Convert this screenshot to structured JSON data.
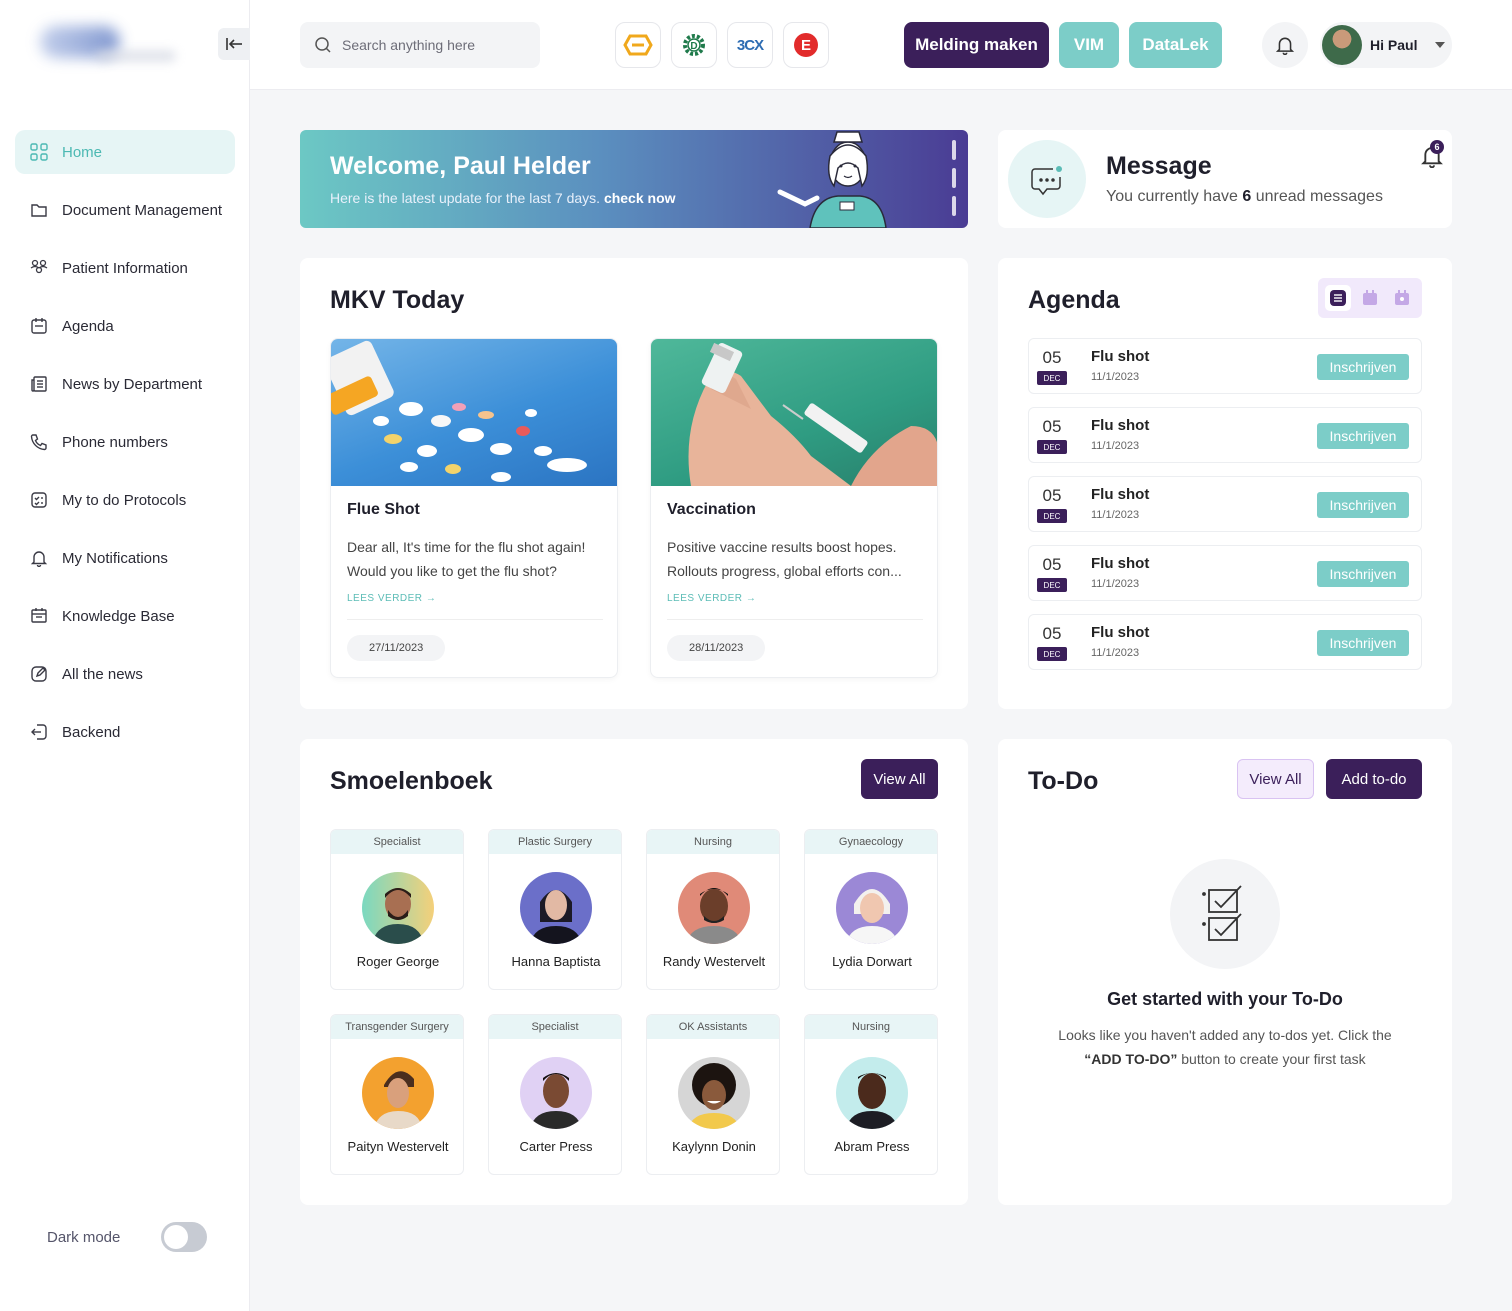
{
  "search": {
    "placeholder": "Search anything here"
  },
  "apps": [
    {
      "name": "hexagon-app",
      "color": "#f0a81c"
    },
    {
      "name": "d-gear-app",
      "label": "D",
      "color": "#1f7a4b"
    },
    {
      "name": "3cx-app",
      "label": "3CX",
      "color": "#2e6db3"
    },
    {
      "name": "e-app",
      "label": "E",
      "color": "#e22b2b"
    }
  ],
  "header": {
    "melding_label": "Melding maken",
    "vim_label": "VIM",
    "datalek_label": "DataLek",
    "user_greeting": "Hi Paul"
  },
  "sidebar": {
    "items": [
      {
        "label": "Home",
        "icon": "grid-icon"
      },
      {
        "label": "Document Management",
        "icon": "folder-icon"
      },
      {
        "label": "Patient Information",
        "icon": "users-icon"
      },
      {
        "label": "Agenda",
        "icon": "calendar-icon"
      },
      {
        "label": "News by Department",
        "icon": "newspaper-icon"
      },
      {
        "label": "Phone numbers",
        "icon": "phone-icon"
      },
      {
        "label": "My to do Protocols",
        "icon": "checklist-icon"
      },
      {
        "label": "My Notifications",
        "icon": "bell-icon"
      },
      {
        "label": "Knowledge Base",
        "icon": "book-icon"
      },
      {
        "label": "All the news",
        "icon": "edit-icon"
      },
      {
        "label": "Backend",
        "icon": "logout-icon"
      }
    ],
    "darkmode_label": "Dark mode"
  },
  "welcome": {
    "title": "Welcome, Paul Helder",
    "subtitle": "Here is the latest update for the last 7 days.",
    "link": "check now"
  },
  "message": {
    "title": "Message",
    "prefix": "You currently have",
    "count": "6",
    "suffix": "unread messages",
    "badge": "6"
  },
  "mkv": {
    "title": "MKV Today",
    "cards": [
      {
        "title": "Flue Shot",
        "desc": "Dear all, It's time for the flu shot again! Would you like to get the flu shot?",
        "more": "LEES VERDER",
        "date": "27/11/2023"
      },
      {
        "title": "Vaccination",
        "desc": "Positive vaccine results boost hopes. Rollouts progress, global efforts con...",
        "more": "LEES VERDER",
        "date": "28/11/2023"
      }
    ]
  },
  "agenda": {
    "title": "Agenda",
    "rows": [
      {
        "day": "05",
        "month": "DEC",
        "title": "Flu shot",
        "date": "11/1/2023",
        "button": "Inschrijven"
      },
      {
        "day": "05",
        "month": "DEC",
        "title": "Flu shot",
        "date": "11/1/2023",
        "button": "Inschrijven"
      },
      {
        "day": "05",
        "month": "DEC",
        "title": "Flu shot",
        "date": "11/1/2023",
        "button": "Inschrijven"
      },
      {
        "day": "05",
        "month": "DEC",
        "title": "Flu shot",
        "date": "11/1/2023",
        "button": "Inschrijven"
      },
      {
        "day": "05",
        "month": "DEC",
        "title": "Flu shot",
        "date": "11/1/2023",
        "button": "Inschrijven"
      }
    ]
  },
  "smoelenboek": {
    "title": "Smoelenboek",
    "view_all": "View All",
    "people": [
      {
        "dept": "Specialist",
        "name": "Roger George"
      },
      {
        "dept": "Plastic Surgery",
        "name": "Hanna Baptista"
      },
      {
        "dept": "Nursing",
        "name": "Randy Westervelt"
      },
      {
        "dept": "Gynaecology",
        "name": "Lydia Dorwart"
      },
      {
        "dept": "Transgender Surgery",
        "name": "Paityn Westervelt"
      },
      {
        "dept": "Specialist",
        "name": "Carter Press"
      },
      {
        "dept": "OK Assistants",
        "name": "Kaylynn Donin"
      },
      {
        "dept": "Nursing",
        "name": "Abram Press"
      }
    ]
  },
  "todo": {
    "title": "To-Do",
    "view_all": "View All",
    "add": "Add to-do",
    "empty_title": "Get started with your To-Do",
    "empty_text_1": "Looks like you haven't added any to-dos yet. Click the",
    "empty_text_bold": "“ADD TO-DO”",
    "empty_text_2": "button to create your first task"
  }
}
